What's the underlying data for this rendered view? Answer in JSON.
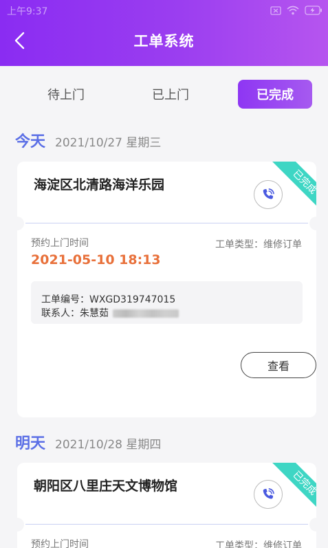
{
  "status_bar": {
    "time": "上午9:37"
  },
  "nav": {
    "title": "工单系统"
  },
  "tabs": [
    {
      "label": "待上门",
      "active": false
    },
    {
      "label": "已上门",
      "active": false
    },
    {
      "label": "已完成",
      "active": true
    }
  ],
  "groups": [
    {
      "day_label": "今天",
      "date": "2021/10/27 星期三",
      "order": {
        "address": "海淀区北清路海洋乐园",
        "status_ribbon": "已完成",
        "appointment_label": "预约上门时间",
        "appointment_time": "2021-05-10 18:13",
        "type_text": "工单类型：维修订单",
        "order_no_text": "工单编号：WXGD319747015",
        "contact_text": "联系人：朱慧茹",
        "view_label": "查看"
      }
    },
    {
      "day_label": "明天",
      "date": "2021/10/28 星期四",
      "order": {
        "address": "朝阳区八里庄天文博物馆",
        "status_ribbon": "已完成",
        "appointment_label": "预约上门时间",
        "type_text": "工单类型：维修订单"
      }
    }
  ],
  "colors": {
    "header_gradient_start": "#8a2cf2",
    "header_gradient_end": "#b655ef",
    "day_label": "#5b6fe6",
    "appointment_time": "#e8703a",
    "ribbon": "#3ed6c4"
  },
  "icons": [
    "back-icon",
    "sim-icon",
    "wifi-icon",
    "battery-charging-icon",
    "phone-call-icon"
  ]
}
